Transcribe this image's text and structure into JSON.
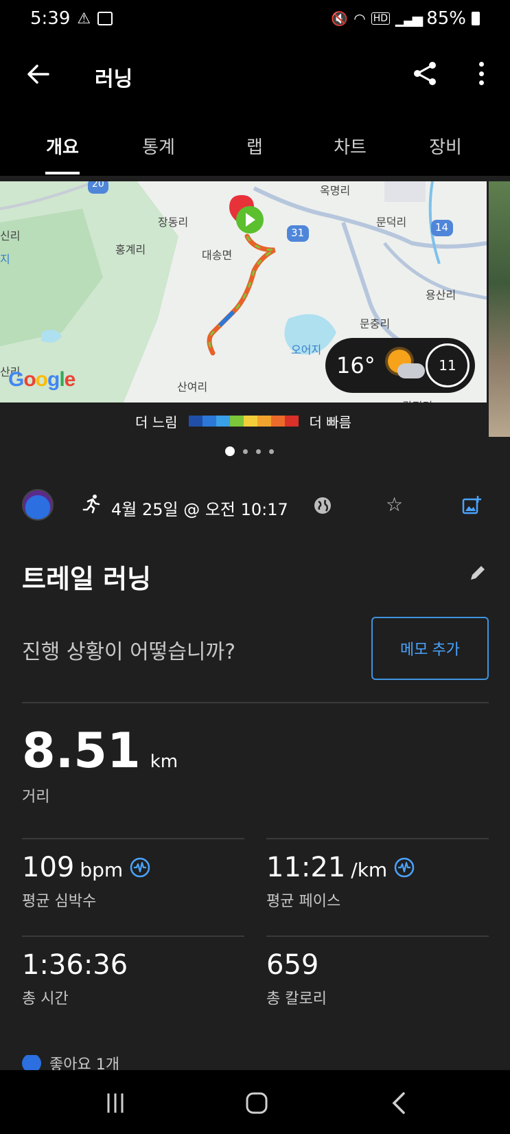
{
  "status_bar": {
    "time": "5:39",
    "battery": "85%"
  },
  "header": {
    "title": "러닝"
  },
  "tabs": [
    {
      "label": "개요"
    },
    {
      "label": "통계"
    },
    {
      "label": "랩"
    },
    {
      "label": "차트"
    },
    {
      "label": "장비"
    }
  ],
  "map": {
    "places": [
      "옥명리",
      "장동리",
      "문덕리",
      "신리",
      "홍계리",
      "대송면",
      "용산리",
      "문충리",
      "오어지",
      "산여리",
      "지",
      "산리",
      "칼평리"
    ],
    "road_numbers": [
      "20",
      "31",
      "14"
    ],
    "weather": {
      "temperature": "16°",
      "wind": "11"
    }
  },
  "legend": {
    "slow_label": "더 느림",
    "fast_label": "더 빠름",
    "colors": [
      "#1f4fa8",
      "#2c78d6",
      "#3aa0e8",
      "#7cc63a",
      "#f2cf3a",
      "#f2a32e",
      "#ec6b2a",
      "#d9302a"
    ]
  },
  "pager": {
    "count": 4,
    "active": 0
  },
  "activity": {
    "date": "4월 25일 @ 오전 10:17",
    "title": "트레일 러닝",
    "prompt": "진행 상황이 어떻습니까?",
    "memo_button": "메모 추가"
  },
  "stats": {
    "distance": {
      "value": "8.51",
      "unit": "km",
      "label": "거리"
    },
    "heart_rate": {
      "value": "109",
      "unit": "bpm",
      "label": "평균 심박수"
    },
    "pace": {
      "value": "11:21",
      "unit": "/km",
      "label": "평균 페이스"
    },
    "total_time": {
      "value": "1:36:36",
      "label": "총 시간"
    },
    "calories": {
      "value": "659",
      "label": "총 칼로리"
    }
  },
  "likes": {
    "text": "좋아요 1개"
  },
  "colors": {
    "accent": "#3f94e0",
    "background": "#1f1f1f",
    "bar": "#000000"
  }
}
